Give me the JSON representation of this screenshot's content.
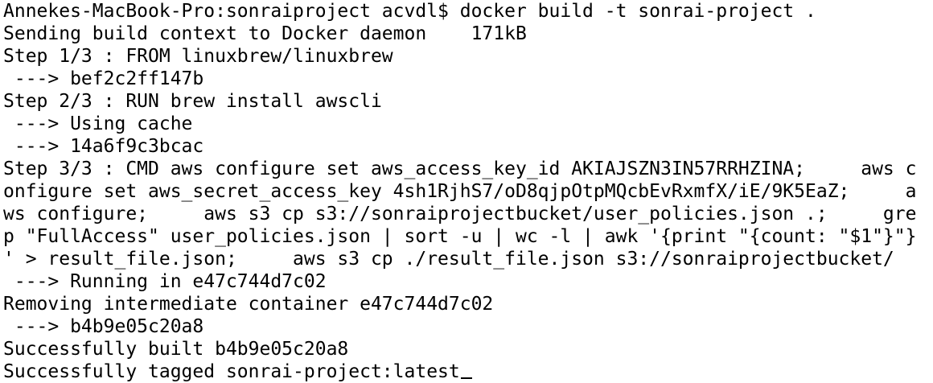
{
  "terminal": {
    "lines": [
      "Annekes-MacBook-Pro:sonraiproject acvdl$ docker build -t sonrai-project .",
      "Sending build context to Docker daemon    171kB",
      "Step 1/3 : FROM linuxbrew/linuxbrew",
      " ---> bef2c2ff147b",
      "Step 2/3 : RUN brew install awscli",
      " ---> Using cache",
      " ---> 14a6f9c3bcac",
      "Step 3/3 : CMD aws configure set aws_access_key_id AKIAJSZN3IN57RRHZINA;     aws c",
      "onfigure set aws_secret_access_key 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;     a",
      "ws configure;     aws s3 cp s3://sonraiprojectbucket/user_policies.json .;     gre",
      "p \"FullAccess\" user_policies.json | sort -u | wc -l | awk '{print \"{count: \"$1\"}\"}",
      "' > result_file.json;     aws s3 cp ./result_file.json s3://sonraiprojectbucket/",
      " ---> Running in e47c744d7c02",
      "Removing intermediate container e47c744d7c02",
      " ---> b4b9e05c20a8",
      "Successfully built b4b9e05c20a8",
      "Successfully tagged sonrai-project:latest"
    ]
  }
}
